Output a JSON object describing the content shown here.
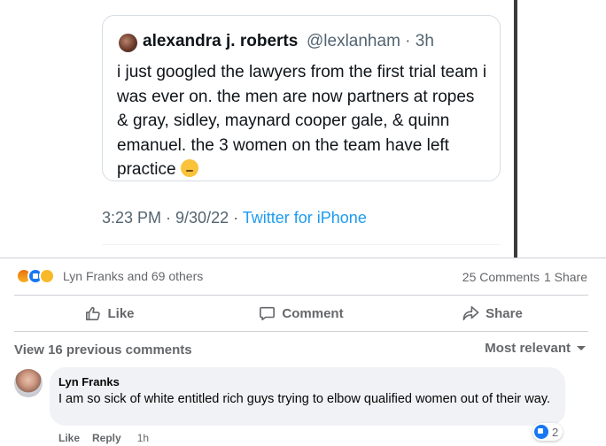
{
  "tweet": {
    "author_name": "alexandra j. roberts",
    "author_handle": "@lexlanham · 3h",
    "text": "i just googled the lawyers from the first trial team i was ever on. the men are now partners at ropes & gray, sidley, maynard cooper gale, & quinn emanuel. the 3 women on the team have left practice",
    "emoji_icon": "thinking-face-icon",
    "time": "3:23 PM · 9/30/22 · ",
    "source": "Twitter for iPhone",
    "source_color": "#1d9bf0"
  },
  "stats": {
    "reaction_icons": [
      "angry-reaction-icon",
      "like-reaction-icon",
      "sad-reaction-icon"
    ],
    "reactors": "Lyn Franks and 69 others",
    "comments": "25 Comments",
    "shares": "1 Share"
  },
  "actions": {
    "like": "Like",
    "comment": "Comment",
    "share": "Share"
  },
  "comments": {
    "view_previous": "View 16 previous comments",
    "sort": "Most relevant",
    "items": [
      {
        "author": "Lyn Franks",
        "text": "I am so sick of white entitled rich guys trying to elbow qualified women out of their way.",
        "like_label": "Like",
        "reply_label": "Reply",
        "time": "1h",
        "reaction_count": "2"
      }
    ]
  },
  "colors": {
    "facebook_blue": "#1877f2",
    "muted_text": "#65676b",
    "bubble_bg": "#f0f2f5"
  }
}
